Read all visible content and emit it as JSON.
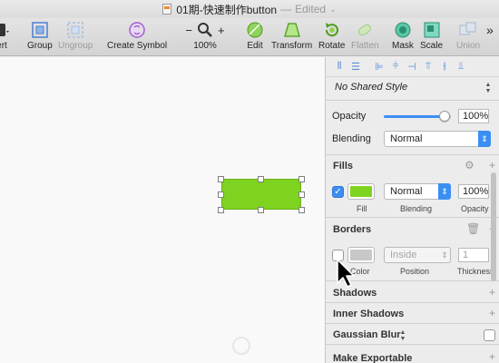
{
  "titlebar": {
    "title": "01期-快速制作button",
    "separator": "—",
    "status": "Edited",
    "chevron": "⌄"
  },
  "toolbar": {
    "insert_label": "ert",
    "group_label": "Group",
    "ungroup_label": "Ungroup",
    "create_symbol_label": "Create Symbol",
    "zoom_minus": "−",
    "zoom_plus": "+",
    "zoom_value": "100%",
    "edit_label": "Edit",
    "transform_label": "Transform",
    "rotate_label": "Rotate",
    "flatten_label": "Flatten",
    "mask_label": "Mask",
    "scale_label": "Scale",
    "union_label": "Union",
    "overflow": "»"
  },
  "inspector": {
    "shared_style": "No Shared Style",
    "opacity_label": "Opacity",
    "opacity_value": "100%",
    "opacity_fraction": 1.0,
    "blending_label": "Blending",
    "blending_value": "Normal",
    "fills": {
      "title": "Fills",
      "color": "#7ed321",
      "blending_value": "Normal",
      "opacity_value": "100%",
      "fill_caption": "Fill",
      "blending_caption": "Blending",
      "opacity_caption": "Opacity",
      "enabled": true
    },
    "borders": {
      "title": "Borders",
      "color": "#c8c8c8",
      "position_value": "Inside",
      "thickness_value": "1",
      "color_caption": "Color",
      "position_caption": "Position",
      "thickness_caption": "Thickness",
      "enabled": false
    },
    "shadows_title": "Shadows",
    "inner_shadows_title": "Inner Shadows",
    "gaussian_blur_title": "Gaussian Blur",
    "make_exportable_title": "Make Exportable"
  },
  "canvas": {
    "shape_color": "#7ed321"
  },
  "colors": {
    "accent": "#3b8ff3"
  }
}
